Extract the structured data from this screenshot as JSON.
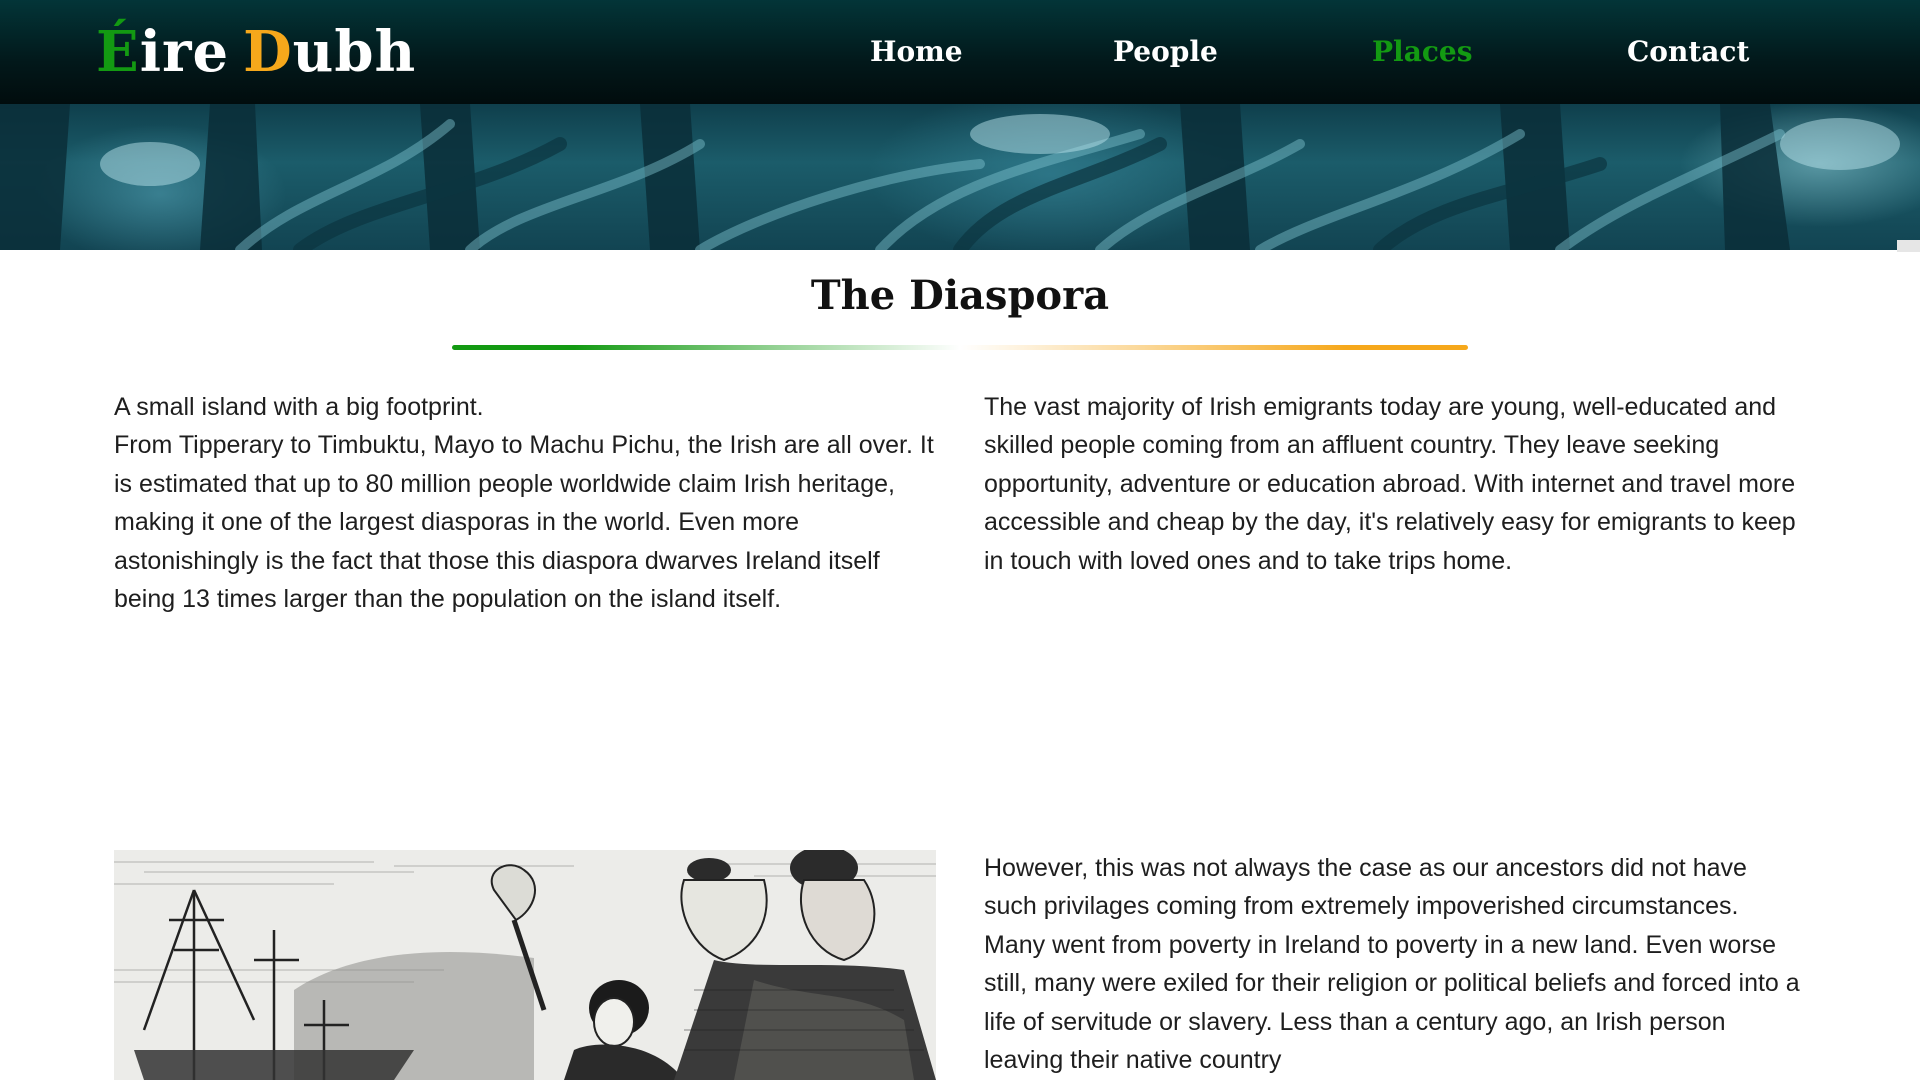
{
  "brand": {
    "word1_initial": "É",
    "word1_rest": "ire",
    "word2_initial": "D",
    "word2_rest": "ubh",
    "colors": {
      "green": "#139a12",
      "orange": "#f6a81b"
    }
  },
  "nav": {
    "items": [
      {
        "label": "Home",
        "active": false
      },
      {
        "label": "People",
        "active": false
      },
      {
        "label": "Places",
        "active": true
      },
      {
        "label": "Contact",
        "active": false
      }
    ]
  },
  "hero": {
    "image": "forest-banner-image"
  },
  "section": {
    "title": "The Diaspora"
  },
  "content": {
    "left_paragraph_1": "A small island with a big footprint.",
    "left_paragraph_2": "From Tipperary to Timbuktu, Mayo to Machu Pichu, the Irish are all over. It is estimated that up to 80 million people worldwide claim Irish heritage, making it one of the largest diasporas in the world. Even more astonishingly is the fact that those this diaspora dwarves Ireland itself being 13 times larger than the population on the island itself.",
    "right_paragraph_1": "The vast majority of Irish emigrants today are young, well-educated and skilled people coming from an affluent country. They leave seeking opportunity, adventure or education abroad. With internet and travel more accessible and cheap by the day, it's relatively easy for emigrants to keep in touch with loved ones and to take trips home.",
    "right_paragraph_2": "However, this was not always the case as our ancestors did not have such privilages coming from extremely impoverished circumstances. Many went from poverty in Ireland to poverty in a new land. Even worse still, many were exiled for their religion or political beliefs and forced into a life of servitude or slavery. Less than a century ago, an Irish person leaving their native country",
    "illustration": "emigrants-engraving-image"
  }
}
